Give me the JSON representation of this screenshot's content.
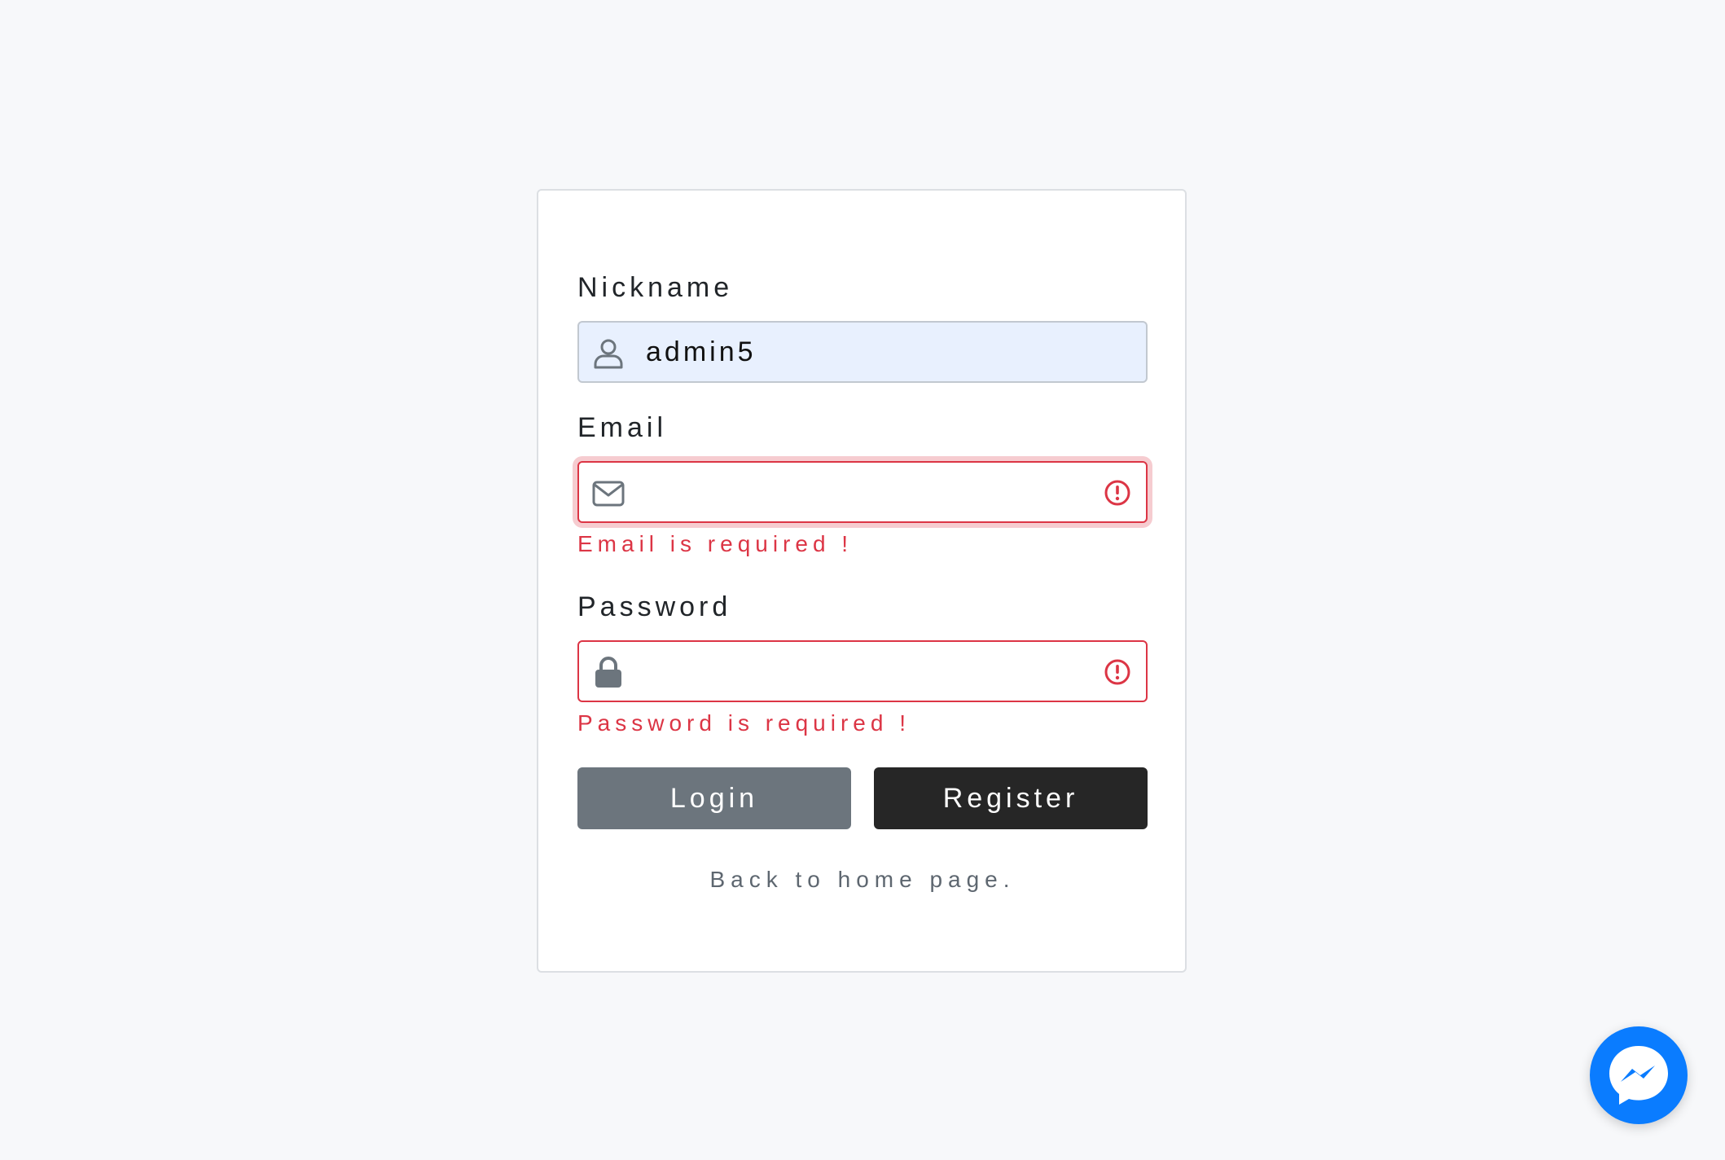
{
  "form": {
    "nickname": {
      "label": "Nickname",
      "value": "admin5",
      "icon": "user-icon"
    },
    "email": {
      "label": "Email",
      "value": "",
      "icon": "envelope-icon",
      "error": "Email is required !",
      "state": "invalid"
    },
    "password": {
      "label": "Password",
      "value": "",
      "icon": "lock-icon",
      "error": "Password is required !",
      "state": "invalid"
    },
    "buttons": {
      "login": "Login",
      "register": "Register"
    },
    "back_link": "Back to home page."
  },
  "chat_widget": {
    "icon": "messenger-icon",
    "color": "#0a7cff"
  },
  "colors": {
    "error": "#dc3545",
    "login_button": "#6c757d",
    "register_button": "#262626",
    "autofill_bg": "#e8f0fe"
  }
}
